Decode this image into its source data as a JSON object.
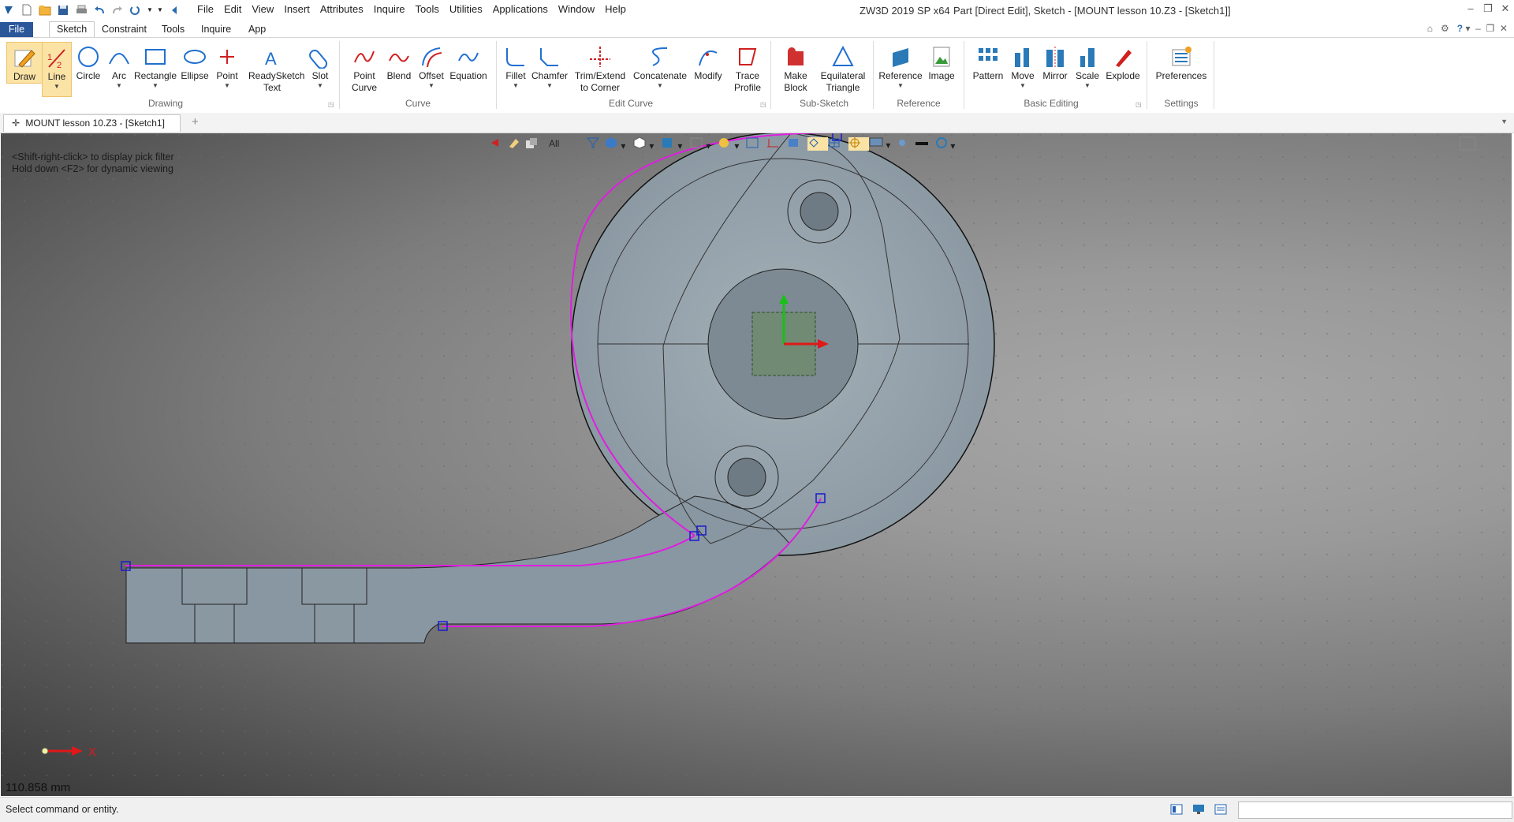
{
  "titlebar": {
    "menu": [
      "File",
      "Edit",
      "View",
      "Insert",
      "Attributes",
      "Inquire",
      "Tools",
      "Utilities",
      "Applications",
      "Window",
      "Help"
    ],
    "app_version": "ZW3D 2019 SP x64",
    "doc_title": "Part [Direct Edit],  Sketch - [MOUNT lesson 10.Z3 - [Sketch1]]",
    "window_controls": [
      "–",
      "❐",
      "✕"
    ]
  },
  "ribbon_tabs": [
    "File",
    "Sketch",
    "Constraint",
    "Tools",
    "Inquire",
    "App"
  ],
  "ribbon": {
    "drawing": {
      "label": "Drawing",
      "buttons": [
        "Draw",
        "Line",
        "Circle",
        "Arc",
        "Rectangle",
        "Ellipse",
        "Point",
        "ReadySketch Text",
        "Slot"
      ]
    },
    "curve": {
      "label": "Curve",
      "buttons": [
        "Point Curve",
        "Blend",
        "Offset",
        "Equation"
      ]
    },
    "edit_curve": {
      "label": "Edit Curve",
      "buttons": [
        "Fillet",
        "Chamfer",
        "Trim/Extend to Corner",
        "Concatenate",
        "Modify",
        "Trace Profile"
      ]
    },
    "sub_sketch": {
      "label": "Sub-Sketch",
      "buttons": [
        "Make Block",
        "Equilateral Triangle"
      ]
    },
    "reference": {
      "label": "Reference",
      "buttons": [
        "Reference",
        "Image"
      ]
    },
    "basic_editing": {
      "label": "Basic Editing",
      "buttons": [
        "Pattern",
        "Move",
        "Mirror",
        "Scale",
        "Explode"
      ]
    },
    "settings": {
      "label": "Settings",
      "buttons": [
        "Preferences"
      ]
    }
  },
  "document_tab": {
    "label": "MOUNT lesson 10.Z3 - [Sketch1]"
  },
  "viewport": {
    "hint_lines": [
      "<Shift-right-click> to display pick filter",
      "Hold down <F2> for dynamic viewing"
    ],
    "filter_label": "All",
    "axis_label": "X",
    "coordinate_readout": "110.858 mm"
  },
  "statusbar": {
    "message": "Select command or entity."
  },
  "colors": {
    "sketch_curve": "#e01ee0",
    "handle": "#1a1acc",
    "accent": "#2b579a"
  }
}
